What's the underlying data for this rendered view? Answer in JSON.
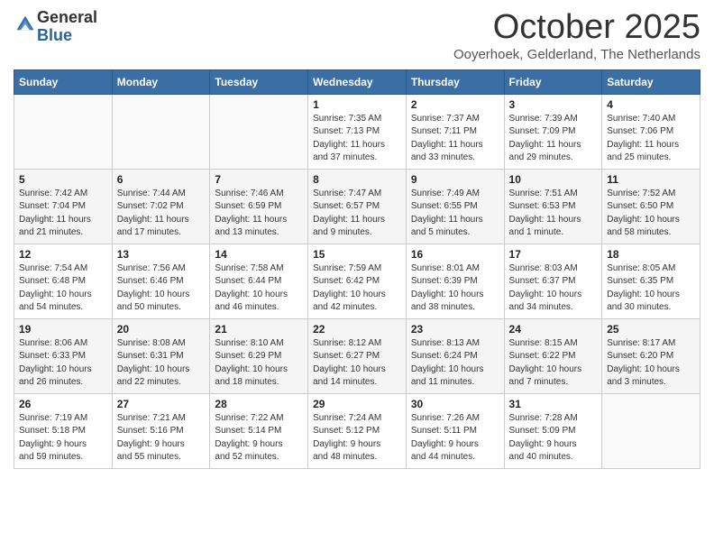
{
  "header": {
    "logo_general": "General",
    "logo_blue": "Blue",
    "month_title": "October 2025",
    "subtitle": "Ooyerhoek, Gelderland, The Netherlands"
  },
  "days_of_week": [
    "Sunday",
    "Monday",
    "Tuesday",
    "Wednesday",
    "Thursday",
    "Friday",
    "Saturday"
  ],
  "weeks": [
    [
      {
        "day": "",
        "info": ""
      },
      {
        "day": "",
        "info": ""
      },
      {
        "day": "",
        "info": ""
      },
      {
        "day": "1",
        "info": "Sunrise: 7:35 AM\nSunset: 7:13 PM\nDaylight: 11 hours\nand 37 minutes."
      },
      {
        "day": "2",
        "info": "Sunrise: 7:37 AM\nSunset: 7:11 PM\nDaylight: 11 hours\nand 33 minutes."
      },
      {
        "day": "3",
        "info": "Sunrise: 7:39 AM\nSunset: 7:09 PM\nDaylight: 11 hours\nand 29 minutes."
      },
      {
        "day": "4",
        "info": "Sunrise: 7:40 AM\nSunset: 7:06 PM\nDaylight: 11 hours\nand 25 minutes."
      }
    ],
    [
      {
        "day": "5",
        "info": "Sunrise: 7:42 AM\nSunset: 7:04 PM\nDaylight: 11 hours\nand 21 minutes."
      },
      {
        "day": "6",
        "info": "Sunrise: 7:44 AM\nSunset: 7:02 PM\nDaylight: 11 hours\nand 17 minutes."
      },
      {
        "day": "7",
        "info": "Sunrise: 7:46 AM\nSunset: 6:59 PM\nDaylight: 11 hours\nand 13 minutes."
      },
      {
        "day": "8",
        "info": "Sunrise: 7:47 AM\nSunset: 6:57 PM\nDaylight: 11 hours\nand 9 minutes."
      },
      {
        "day": "9",
        "info": "Sunrise: 7:49 AM\nSunset: 6:55 PM\nDaylight: 11 hours\nand 5 minutes."
      },
      {
        "day": "10",
        "info": "Sunrise: 7:51 AM\nSunset: 6:53 PM\nDaylight: 11 hours\nand 1 minute."
      },
      {
        "day": "11",
        "info": "Sunrise: 7:52 AM\nSunset: 6:50 PM\nDaylight: 10 hours\nand 58 minutes."
      }
    ],
    [
      {
        "day": "12",
        "info": "Sunrise: 7:54 AM\nSunset: 6:48 PM\nDaylight: 10 hours\nand 54 minutes."
      },
      {
        "day": "13",
        "info": "Sunrise: 7:56 AM\nSunset: 6:46 PM\nDaylight: 10 hours\nand 50 minutes."
      },
      {
        "day": "14",
        "info": "Sunrise: 7:58 AM\nSunset: 6:44 PM\nDaylight: 10 hours\nand 46 minutes."
      },
      {
        "day": "15",
        "info": "Sunrise: 7:59 AM\nSunset: 6:42 PM\nDaylight: 10 hours\nand 42 minutes."
      },
      {
        "day": "16",
        "info": "Sunrise: 8:01 AM\nSunset: 6:39 PM\nDaylight: 10 hours\nand 38 minutes."
      },
      {
        "day": "17",
        "info": "Sunrise: 8:03 AM\nSunset: 6:37 PM\nDaylight: 10 hours\nand 34 minutes."
      },
      {
        "day": "18",
        "info": "Sunrise: 8:05 AM\nSunset: 6:35 PM\nDaylight: 10 hours\nand 30 minutes."
      }
    ],
    [
      {
        "day": "19",
        "info": "Sunrise: 8:06 AM\nSunset: 6:33 PM\nDaylight: 10 hours\nand 26 minutes."
      },
      {
        "day": "20",
        "info": "Sunrise: 8:08 AM\nSunset: 6:31 PM\nDaylight: 10 hours\nand 22 minutes."
      },
      {
        "day": "21",
        "info": "Sunrise: 8:10 AM\nSunset: 6:29 PM\nDaylight: 10 hours\nand 18 minutes."
      },
      {
        "day": "22",
        "info": "Sunrise: 8:12 AM\nSunset: 6:27 PM\nDaylight: 10 hours\nand 14 minutes."
      },
      {
        "day": "23",
        "info": "Sunrise: 8:13 AM\nSunset: 6:24 PM\nDaylight: 10 hours\nand 11 minutes."
      },
      {
        "day": "24",
        "info": "Sunrise: 8:15 AM\nSunset: 6:22 PM\nDaylight: 10 hours\nand 7 minutes."
      },
      {
        "day": "25",
        "info": "Sunrise: 8:17 AM\nSunset: 6:20 PM\nDaylight: 10 hours\nand 3 minutes."
      }
    ],
    [
      {
        "day": "26",
        "info": "Sunrise: 7:19 AM\nSunset: 5:18 PM\nDaylight: 9 hours\nand 59 minutes."
      },
      {
        "day": "27",
        "info": "Sunrise: 7:21 AM\nSunset: 5:16 PM\nDaylight: 9 hours\nand 55 minutes."
      },
      {
        "day": "28",
        "info": "Sunrise: 7:22 AM\nSunset: 5:14 PM\nDaylight: 9 hours\nand 52 minutes."
      },
      {
        "day": "29",
        "info": "Sunrise: 7:24 AM\nSunset: 5:12 PM\nDaylight: 9 hours\nand 48 minutes."
      },
      {
        "day": "30",
        "info": "Sunrise: 7:26 AM\nSunset: 5:11 PM\nDaylight: 9 hours\nand 44 minutes."
      },
      {
        "day": "31",
        "info": "Sunrise: 7:28 AM\nSunset: 5:09 PM\nDaylight: 9 hours\nand 40 minutes."
      },
      {
        "day": "",
        "info": ""
      }
    ]
  ]
}
